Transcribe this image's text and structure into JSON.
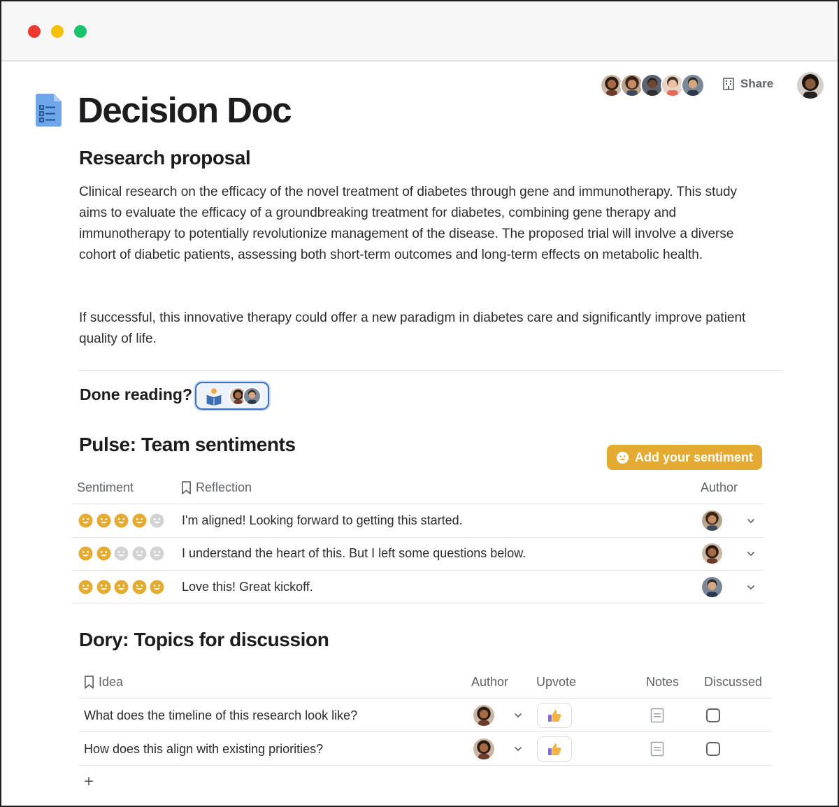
{
  "document": {
    "title": "Decision Doc"
  },
  "header": {
    "share_label": "Share"
  },
  "research": {
    "heading": "Research proposal",
    "paragraph_1": "Clinical research on the efficacy of the novel treatment of diabetes through gene and immunotherapy. This study aims to evaluate the efficacy of a groundbreaking treatment for diabetes, combining gene therapy and immunotherapy to potentially revolutionize management of the disease. The proposed trial will involve a diverse cohort of diabetic patients, assessing both short-term outcomes and long-term effects on metabolic health.",
    "paragraph_2": "If successful, this innovative therapy could offer a new paradigm in diabetes care and significantly improve patient quality of life."
  },
  "done_reading": {
    "label": "Done reading?"
  },
  "pulse": {
    "heading": "Pulse: Team sentiments",
    "add_button": "Add your sentiment",
    "columns": {
      "sentiment": "Sentiment",
      "reflection": "Reflection",
      "author": "Author"
    },
    "rows": [
      {
        "rating": 4,
        "max": 5,
        "reflection": "I'm aligned! Looking forward to getting this started."
      },
      {
        "rating": 2,
        "max": 5,
        "reflection": "I understand the heart of this. But I left some questions below."
      },
      {
        "rating": 5,
        "max": 5,
        "reflection": "Love this! Great kickoff."
      }
    ]
  },
  "dory": {
    "heading": "Dory: Topics for discussion",
    "columns": {
      "idea": "Idea",
      "author": "Author",
      "upvote": "Upvote",
      "notes": "Notes",
      "discussed": "Discussed"
    },
    "rows": [
      {
        "idea": "What does the timeline of this research look like?",
        "discussed": false
      },
      {
        "idea": "How does this align with existing priorities?",
        "discussed": false
      }
    ],
    "add_symbol": "+"
  },
  "colors": {
    "accent": "#e5aa31",
    "emoji_active": "#e5aa31",
    "emoji_inactive": "#d3d3d3",
    "chip_border": "#3d6fb5"
  }
}
